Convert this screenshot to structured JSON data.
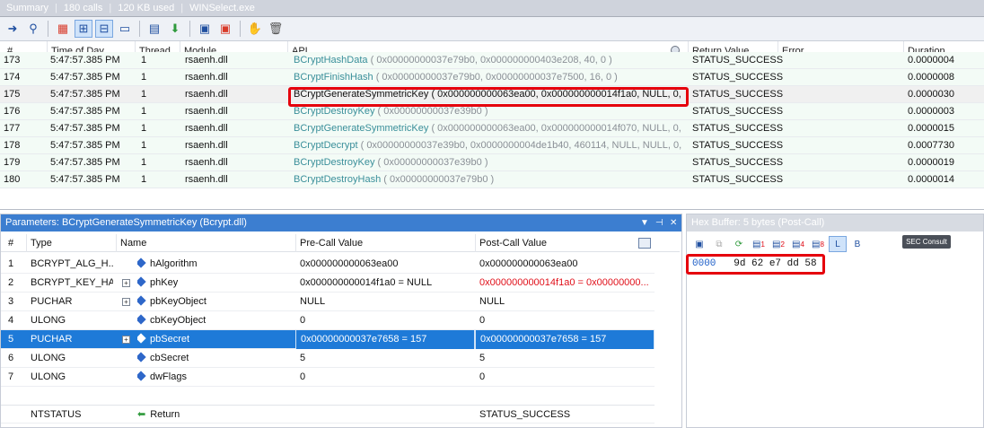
{
  "status": {
    "summary": "Summary",
    "calls": "180 calls",
    "used": "120 KB used",
    "exe": "WINSelect.exe"
  },
  "toolbar": {
    "icons": [
      "arrow-right",
      "binoculars",
      "grid-color",
      "tree-select",
      "tree-active",
      "console",
      "table",
      "import",
      "api-select",
      "api-remove",
      "hand",
      "trash"
    ]
  },
  "grid": {
    "headers": {
      "num": "#",
      "time": "Time of Day",
      "thread": "Thread",
      "module": "Module",
      "api": "API",
      "return": "Return Value",
      "error": "Error",
      "duration": "Duration"
    },
    "rows": [
      {
        "num": "173",
        "time": "5:47:57.385 PM",
        "thread": "1",
        "module": "rsaenh.dll",
        "api": "BCryptHashData",
        "args": "( 0x00000000037e79b0, 0x000000000403e208, 40, 0 )",
        "ret": "STATUS_SUCCESS",
        "dur": "0.0000004"
      },
      {
        "num": "174",
        "time": "5:47:57.385 PM",
        "thread": "1",
        "module": "rsaenh.dll",
        "api": "BCryptFinishHash",
        "args": "( 0x00000000037e79b0, 0x00000000037e7500, 16, 0 )",
        "ret": "STATUS_SUCCESS",
        "dur": "0.0000008"
      },
      {
        "num": "175",
        "time": "5:47:57.385 PM",
        "thread": "1",
        "module": "rsaenh.dll",
        "api": "BCryptGenerateSymmetricKey",
        "args": "( 0x000000000063ea00, 0x000000000014f1a0, NULL, 0, 0",
        "ret": "STATUS_SUCCESS",
        "dur": "0.0000030"
      },
      {
        "num": "176",
        "time": "5:47:57.385 PM",
        "thread": "1",
        "module": "rsaenh.dll",
        "api": "BCryptDestroyKey",
        "args": "( 0x00000000037e39b0 )",
        "ret": "STATUS_SUCCESS",
        "dur": "0.0000003"
      },
      {
        "num": "177",
        "time": "5:47:57.385 PM",
        "thread": "1",
        "module": "rsaenh.dll",
        "api": "BCryptGenerateSymmetricKey",
        "args": "( 0x000000000063ea00, 0x000000000014f070, NULL, 0, 0",
        "ret": "STATUS_SUCCESS",
        "dur": "0.0000015"
      },
      {
        "num": "178",
        "time": "5:47:57.385 PM",
        "thread": "1",
        "module": "rsaenh.dll",
        "api": "BCryptDecrypt",
        "args": "( 0x00000000037e39b0, 0x0000000004de1b40, 460114, NULL, NULL, 0, 0",
        "ret": "STATUS_SUCCESS",
        "dur": "0.0007730"
      },
      {
        "num": "179",
        "time": "5:47:57.385 PM",
        "thread": "1",
        "module": "rsaenh.dll",
        "api": "BCryptDestroyKey",
        "args": "( 0x00000000037e39b0 )",
        "ret": "STATUS_SUCCESS",
        "dur": "0.0000019"
      },
      {
        "num": "180",
        "time": "5:47:57.385 PM",
        "thread": "1",
        "module": "rsaenh.dll",
        "api": "BCryptDestroyHash",
        "args": "( 0x00000000037e79b0 )",
        "ret": "STATUS_SUCCESS",
        "dur": "0.0000014"
      }
    ],
    "selected_row": "175"
  },
  "params": {
    "title": "Parameters: BCryptGenerateSymmetricKey (Bcrypt.dll)",
    "headers": {
      "num": "#",
      "type": "Type",
      "name": "Name",
      "pre": "Pre-Call Value",
      "post": "Post-Call Value"
    },
    "rows": [
      {
        "num": "1",
        "type": "BCRYPT_ALG_H...",
        "name": "hAlgorithm",
        "pre": "0x000000000063ea00",
        "post": "0x000000000063ea00"
      },
      {
        "num": "2",
        "type": "BCRYPT_KEY_HA...",
        "name": "phKey",
        "pre": "0x000000000014f1a0 = NULL",
        "post": "0x000000000014f1a0 = 0x00000000..."
      },
      {
        "num": "3",
        "type": "PUCHAR",
        "name": "pbKeyObject",
        "pre": "NULL",
        "post": "NULL"
      },
      {
        "num": "4",
        "type": "ULONG",
        "name": "cbKeyObject",
        "pre": "0",
        "post": "0"
      },
      {
        "num": "5",
        "type": "PUCHAR",
        "name": "pbSecret",
        "pre": "0x00000000037e7658 = 157",
        "post": "0x00000000037e7658 = 157"
      },
      {
        "num": "6",
        "type": "ULONG",
        "name": "cbSecret",
        "pre": "5",
        "post": "5"
      },
      {
        "num": "7",
        "type": "ULONG",
        "name": "dwFlags",
        "pre": "0",
        "post": "0"
      }
    ],
    "return": {
      "type": "NTSTATUS",
      "name": "Return",
      "post": "STATUS_SUCCESS"
    },
    "selected_row": "5"
  },
  "hex": {
    "title": "Hex Buffer: 5 bytes (Post-Call)",
    "offset": "0000",
    "bytes": "9d 62 e7 dd 58",
    "buttons": [
      "1",
      "2",
      "4",
      "8"
    ],
    "logo": "SEC Consult"
  }
}
